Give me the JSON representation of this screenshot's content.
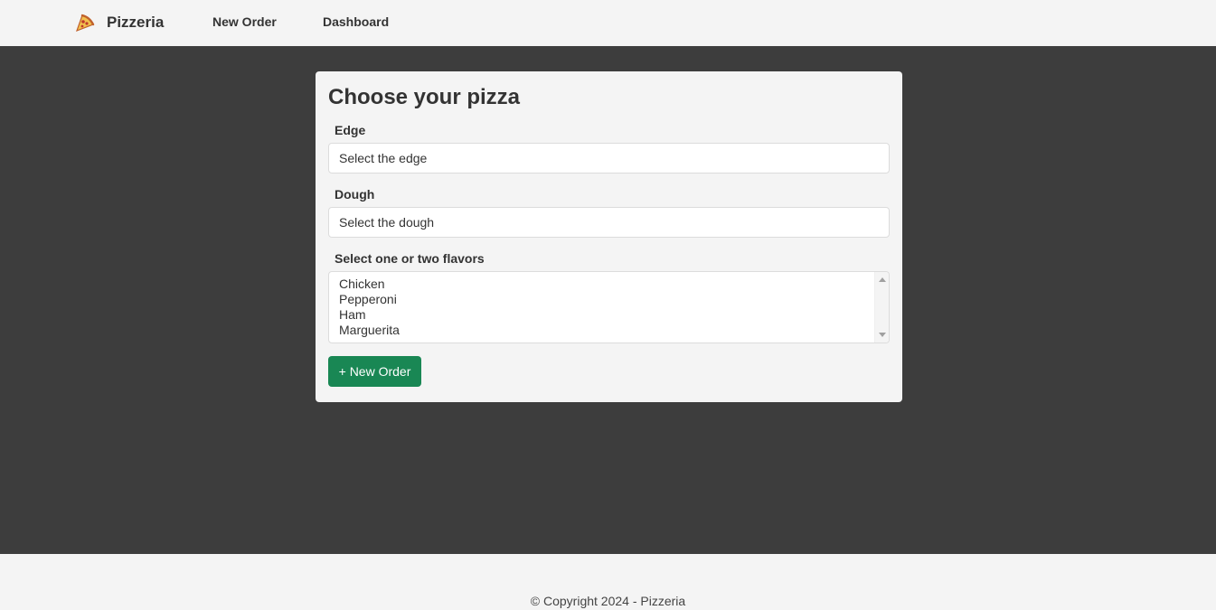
{
  "navbar": {
    "brand_icon": "pizza-slice-icon",
    "brand_label": "Pizzeria",
    "links": [
      {
        "label": "New Order"
      },
      {
        "label": "Dashboard"
      }
    ]
  },
  "form": {
    "title": "Choose your pizza",
    "edge": {
      "label": "Edge",
      "selected": "Select the edge"
    },
    "dough": {
      "label": "Dough",
      "selected": "Select the dough"
    },
    "flavors": {
      "label": "Select one or two flavors",
      "options": [
        "Chicken",
        "Pepperoni",
        "Ham",
        "Marguerita"
      ]
    },
    "submit_label": "+ New Order"
  },
  "footer": {
    "copyright": "© Copyright 2024 - Pizzeria"
  },
  "colors": {
    "main_background": "#3d3d3d",
    "surface": "#f4f4f4",
    "accent_button": "#198754",
    "text": "#333333"
  }
}
